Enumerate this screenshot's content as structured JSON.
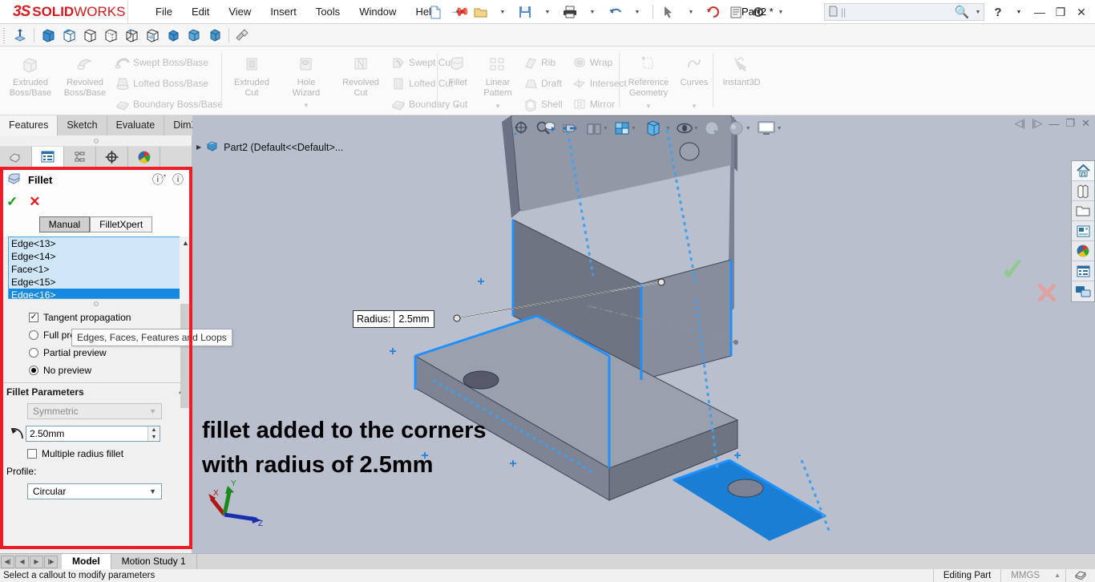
{
  "app": {
    "brand_ds": "ƨS",
    "brand_solid": "SOLID",
    "brand_works": "WORKS",
    "document_title": "Part2 *",
    "accent_red": "#ee1c25",
    "accent_blue": "#1489dd"
  },
  "menubar": {
    "items": [
      {
        "label": "File"
      },
      {
        "label": "Edit"
      },
      {
        "label": "View"
      },
      {
        "label": "Insert"
      },
      {
        "label": "Tools"
      },
      {
        "label": "Window"
      },
      {
        "label": "Help"
      }
    ],
    "pin_icon": "pin-icon"
  },
  "titlebar_right": {
    "search_placeholder": "",
    "search_icon": "search-icon",
    "search_dropdown_icon": "chevron-down-icon",
    "help_icon": "question-mark-icon",
    "help_dropdown_icon": "chevron-down-icon",
    "minimize_icon": "minimize-icon",
    "restore_icon": "restore-icon",
    "close_icon": "close-icon"
  },
  "quick_toolbar": {
    "items": [
      {
        "name": "new-document-icon"
      },
      {
        "name": "open-document-icon"
      },
      {
        "name": "save-icon"
      },
      {
        "name": "print-icon"
      },
      {
        "name": "undo-icon"
      },
      {
        "name": "select-icon"
      },
      {
        "name": "rebuild-icon"
      },
      {
        "name": "file-properties-icon"
      },
      {
        "name": "options-gear-icon"
      }
    ]
  },
  "view_toolbar": {
    "items": [
      {
        "name": "reference-triad-icon"
      },
      {
        "name": "shaded-box-icon"
      },
      {
        "name": "shaded-with-edges-box-icon"
      },
      {
        "name": "hidden-lines-removed-box-icon"
      },
      {
        "name": "hidden-lines-visible-box-icon"
      },
      {
        "name": "wireframe-box-icon"
      },
      {
        "name": "draft-quality-box-icon"
      },
      {
        "name": "perspective-box-icon"
      },
      {
        "name": "shadows-box-icon"
      },
      {
        "name": "section-view-box-icon"
      },
      {
        "name": "appearance-brush-icon"
      }
    ]
  },
  "ribbon": {
    "groups": [
      {
        "name": "boss-base",
        "big_buttons": [
          {
            "label_line1": "Extruded",
            "label_line2": "Boss/Base",
            "icon": "extruded-boss-icon"
          },
          {
            "label_line1": "Revolved",
            "label_line2": "Boss/Base",
            "icon": "revolved-boss-icon"
          }
        ],
        "small_buttons": [
          {
            "label": "Swept Boss/Base",
            "icon": "swept-boss-icon"
          },
          {
            "label": "Lofted Boss/Base",
            "icon": "lofted-boss-icon"
          },
          {
            "label": "Boundary Boss/Base",
            "icon": "boundary-boss-icon"
          }
        ]
      },
      {
        "name": "cut",
        "big_buttons": [
          {
            "label_line1": "Extruded",
            "label_line2": "Cut",
            "icon": "extruded-cut-icon"
          },
          {
            "label_line1": "Hole",
            "label_line2": "Wizard",
            "icon": "hole-wizard-icon"
          },
          {
            "label_line1": "Revolved",
            "label_line2": "Cut",
            "icon": "revolved-cut-icon"
          }
        ],
        "small_buttons": [
          {
            "label": "Swept Cut",
            "icon": "swept-cut-icon"
          },
          {
            "label": "Lofted Cut",
            "icon": "lofted-cut-icon"
          },
          {
            "label": "Boundary Cut",
            "icon": "boundary-cut-icon"
          }
        ]
      },
      {
        "name": "features",
        "big_buttons": [
          {
            "label_line1": "Fillet",
            "label_line2": "",
            "icon": "fillet-icon"
          },
          {
            "label_line1": "Linear",
            "label_line2": "Pattern",
            "icon": "linear-pattern-icon"
          }
        ],
        "small_buttons": [
          {
            "label": "Rib",
            "icon": "rib-icon"
          },
          {
            "label": "Draft",
            "icon": "draft-icon"
          },
          {
            "label": "Shell",
            "icon": "shell-icon"
          }
        ],
        "small_buttons2": [
          {
            "label": "Wrap",
            "icon": "wrap-icon"
          },
          {
            "label": "Intersect",
            "icon": "intersect-icon"
          },
          {
            "label": "Mirror",
            "icon": "mirror-icon"
          }
        ]
      },
      {
        "name": "reference",
        "big_buttons": [
          {
            "label_line1": "Reference",
            "label_line2": "Geometry",
            "icon": "reference-geometry-icon"
          },
          {
            "label_line1": "Curves",
            "label_line2": "",
            "icon": "curves-icon"
          }
        ]
      },
      {
        "name": "instant3d",
        "big_buttons": [
          {
            "label_line1": "Instant3D",
            "label_line2": "",
            "icon": "instant3d-icon"
          }
        ]
      }
    ]
  },
  "command_tabs": {
    "items": [
      {
        "label": "Features",
        "active": true
      },
      {
        "label": "Sketch",
        "active": false
      },
      {
        "label": "Evaluate",
        "active": false
      },
      {
        "label": "DimXpert",
        "active": false
      }
    ]
  },
  "property_manager_tabs": {
    "items": [
      {
        "name": "feature-manager-tree-icon",
        "active": false
      },
      {
        "name": "property-manager-icon",
        "active": true
      },
      {
        "name": "configuration-manager-icon",
        "active": false
      },
      {
        "name": "dimxpert-manager-icon",
        "active": false
      },
      {
        "name": "display-manager-icon",
        "active": false
      }
    ]
  },
  "fillet_panel": {
    "icon": "fillet-feature-icon",
    "title": "Fillet",
    "help_custom_icon": "help-star-icon",
    "help_icon": "help-icon",
    "ok_icon": "checkmark-icon",
    "cancel_icon": "cancel-x-icon",
    "modes": [
      {
        "label": "Manual",
        "selected": true
      },
      {
        "label": "FilletXpert",
        "selected": false
      }
    ],
    "items_to_fillet": [
      {
        "label": "Edge<13>",
        "selected": false
      },
      {
        "label": "Edge<14>",
        "selected": false
      },
      {
        "label": "Face<1>",
        "selected": false
      },
      {
        "label": "Edge<15>",
        "selected": false
      },
      {
        "label": "Edge<16>",
        "selected": true
      }
    ],
    "tooltip": "Edges, Faces, Features and Loops",
    "tangent_propagation": {
      "label": "Tangent propagation",
      "checked": true
    },
    "preview_options": [
      {
        "label": "Full preview",
        "selected": false
      },
      {
        "label": "Partial preview",
        "selected": false
      },
      {
        "label": "No preview",
        "selected": true
      }
    ],
    "parameters_section": {
      "title": "Fillet Parameters",
      "collapse_icon": "chevron-up-icon",
      "symmetry_value": "Symmetric",
      "radius_icon": "radius-icon",
      "radius_value": "2.50mm",
      "multiple_radius": {
        "label": "Multiple radius fillet",
        "checked": false
      },
      "profile_label": "Profile:",
      "profile_value": "Circular"
    }
  },
  "viewport": {
    "tree_root": "Part2  (Default<<Default>...",
    "expand_icon": "expand-arrow-icon",
    "part_icon": "part-document-icon",
    "toolbar": [
      {
        "name": "zoom-to-fit-icon"
      },
      {
        "name": "zoom-to-area-icon"
      },
      {
        "name": "previous-view-icon"
      },
      {
        "name": "section-view-icon"
      },
      {
        "name": "view-orientation-icon"
      },
      {
        "name": "display-style-icon"
      },
      {
        "name": "hide-show-items-icon"
      },
      {
        "name": "edit-appearance-icon"
      },
      {
        "name": "apply-scene-icon"
      },
      {
        "name": "view-settings-icon"
      }
    ],
    "window_buttons": [
      {
        "name": "tile-left-icon"
      },
      {
        "name": "tile-right-icon"
      },
      {
        "name": "minimize-window-icon"
      },
      {
        "name": "restore-window-icon"
      },
      {
        "name": "close-window-icon"
      }
    ],
    "confirm_corner": {
      "ok_icon": "confirm-checkmark-icon",
      "cancel_icon": "confirm-x-icon"
    },
    "callout": {
      "label": "Radius:",
      "value": "2.5mm"
    },
    "annotation_line1": "fillet added to the corners",
    "annotation_line2": "with radius of 2.5mm",
    "triad": {
      "x_label": "X",
      "y_label": "Y",
      "z_label": "Z"
    }
  },
  "right_dock": {
    "items": [
      {
        "name": "design-library-home-icon"
      },
      {
        "name": "design-library-icon"
      },
      {
        "name": "file-explorer-icon"
      },
      {
        "name": "view-palette-icon"
      },
      {
        "name": "appearances-scenes-icon"
      },
      {
        "name": "custom-properties-icon"
      },
      {
        "name": "3d-views-icon"
      }
    ]
  },
  "bottom_tabs": {
    "nav": [
      {
        "name": "first-tab-icon"
      },
      {
        "name": "previous-tab-icon"
      },
      {
        "name": "next-tab-icon"
      },
      {
        "name": "last-tab-icon"
      }
    ],
    "items": [
      {
        "label": "Model",
        "active": true
      },
      {
        "label": "Motion Study 1",
        "active": false
      }
    ]
  },
  "status_bar": {
    "message": "Select a callout to modify parameters",
    "editing_state": "Editing Part",
    "units": "MMGS",
    "units_dropdown_icon": "chevron-up-icon",
    "overlay_icon": "overlay-icon"
  }
}
